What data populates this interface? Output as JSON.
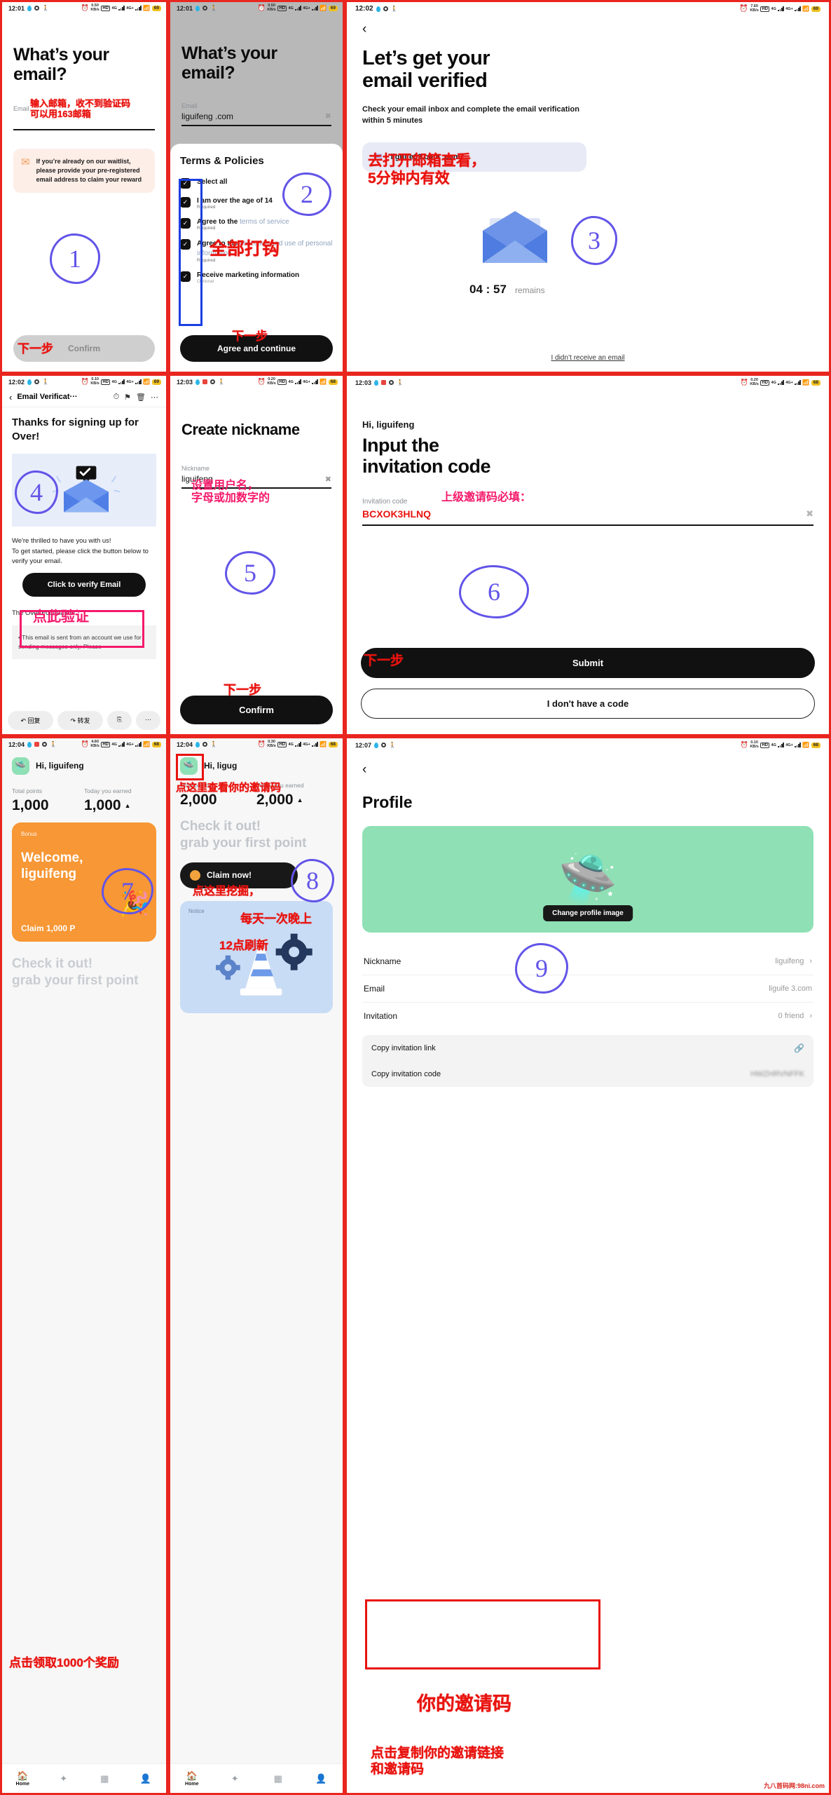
{
  "meta": {
    "watermark": "九八首码网:98ni.com"
  },
  "panels": {
    "p1": {
      "status": {
        "time": "12:01",
        "speed": "0.50",
        "unit": "KB/s",
        "battery": "69",
        "hd": "HD",
        "net": "4G",
        "net2": "4G+"
      },
      "title": "What’s your\nemail?",
      "field_label": "Email",
      "field_value": "",
      "notice": "If you’re already on our waitlist, please provide your pre-registered email address to claim your reward",
      "notice_icon": "envelope-icon",
      "confirm_label": "Confirm",
      "ann_red": "输入邮箱，收不到验证码\n可以用163邮箱",
      "ann_step": "下一步",
      "step_number": "1"
    },
    "p2": {
      "status": {
        "time": "12:01",
        "speed": "0.50",
        "unit": "KB/s",
        "battery": "69",
        "hd": "HD",
        "net": "4G",
        "net2": "4G+"
      },
      "title": "What’s your\nemail?",
      "field_label": "Email",
      "field_value": "liguifeng        .com",
      "clear_icon": "clear-icon",
      "sheet_title": "Terms & Policies",
      "terms": [
        {
          "label": "Select all",
          "link": "",
          "sub": "",
          "checked": true
        },
        {
          "label": "I am over the age of 14",
          "link": "",
          "sub": "Required",
          "checked": true
        },
        {
          "label": "Agree to the ",
          "link": "terms of service",
          "sub": "Required",
          "checked": true
        },
        {
          "label": "Agree to the ",
          "link": "collection and use of personal information",
          "sub": "Required",
          "checked": true
        },
        {
          "label": "Receive marketing information",
          "link": "",
          "sub": "Optional",
          "checked": true
        }
      ],
      "agree_label": "Agree and continue",
      "ann_red": "全部打钩",
      "ann_step": "下一步",
      "step_number": "2"
    },
    "p3": {
      "status": {
        "time": "12:02",
        "speed": "7.60",
        "unit": "KB/s",
        "battery": "69",
        "hd": "HD",
        "net": "4G",
        "net2": "4G+"
      },
      "back_icon": "back-chevron-icon",
      "title": "Let’s get your\nemail verified",
      "subtitle": "Check your email inbox and complete the email verification within 5 minutes",
      "email_chip": "liguife63.com      .com",
      "email_chip_icon": "envelope-icon",
      "illustration": "open-envelope-icon",
      "timer": "04 : 57",
      "timer_suffix": "remains",
      "resend_link": "I didn’t receive an email",
      "ann_red": "去打开邮箱查看，\n5分钟内有效",
      "step_number": "3"
    },
    "p4": {
      "status": {
        "time": "12:02",
        "speed": "0.10",
        "unit": "KB/s",
        "battery": "69",
        "hd": "HD",
        "net": "4G",
        "net2": "4G+"
      },
      "mail_subject": "Email Verificat···",
      "toolbar_icons": [
        "back-chevron-icon",
        "clock-icon",
        "flag-icon",
        "trash-icon",
        "more-icon"
      ],
      "heading": "Thanks for signing up for Over!",
      "hero_icon": "verified-envelope-icon",
      "body": "We're thrilled to have you with us!\nTo get started, please click the button below to verify your email.",
      "cta_label": "Click to verify Email",
      "signature": "The Over Foundation",
      "disclaimer": "• This email is sent from an account we use for sending messages only. Please",
      "actions": [
        {
          "icon": "reply-icon",
          "label": "回复"
        },
        {
          "icon": "forward-icon",
          "label": "转发"
        },
        {
          "icon": "archive-icon",
          "label": ""
        },
        {
          "icon": "more-icon",
          "label": ""
        }
      ],
      "ann_pink": "点此验证",
      "step_number": "4"
    },
    "p5": {
      "status": {
        "time": "12:03",
        "speed": "0.20",
        "unit": "KB/s",
        "battery": "68",
        "hd": "HD",
        "net": "4G",
        "net2": "4G+"
      },
      "title": "Create nickname",
      "field_label": "Nickname",
      "field_value": "liguifeng",
      "clear_icon": "clear-icon",
      "confirm_label": "Confirm",
      "ann_pink": "设置用户名，\n字母或加数字的",
      "ann_step": "下一步",
      "step_number": "5"
    },
    "p6": {
      "status": {
        "time": "12:03",
        "speed": "0.20",
        "unit": "KB/s",
        "battery": "68",
        "hd": "HD",
        "net": "4G",
        "net2": "4G+"
      },
      "greeting": "Hi, liguifeng",
      "title": "Input the\ninvitation code",
      "field_label": "Invitation code",
      "field_value": "BCXOK3HLNQ",
      "clear_icon": "clear-icon",
      "submit_label": "Submit",
      "nocode_label": "I don't have a code",
      "ann_pink": "上级邀请码必填：",
      "ann_step": "下一步",
      "step_number": "6"
    },
    "p7": {
      "status": {
        "time": "12:04",
        "speed": "4.60",
        "unit": "KB/s",
        "battery": "68",
        "hd": "HD",
        "net": "4G",
        "net2": "4G+"
      },
      "avatar_icon": "alien-avatar-icon",
      "greeting": "Hi, liguifeng",
      "stats": [
        {
          "label": "Total points",
          "value": "1,000"
        },
        {
          "label": "Today you earned",
          "value": "1,000",
          "caret": "▲"
        }
      ],
      "bonus_tag": "Bonus",
      "bonus_title": "Welcome,\nliguifeng",
      "bonus_cta": "Claim 1,000 P",
      "promo": "Check it out!\ngrab your first point",
      "nav": [
        {
          "icon": "home-icon",
          "label": "Home",
          "active": true
        },
        {
          "icon": "sparkle-icon",
          "label": "",
          "active": false
        },
        {
          "icon": "card-icon",
          "label": "",
          "active": false
        },
        {
          "icon": "person-icon",
          "label": "",
          "active": false
        }
      ],
      "ann_red": "点击领取1000个奖励",
      "step_number": "7"
    },
    "p8": {
      "status": {
        "time": "12:04",
        "speed": "0.30",
        "unit": "KB/s",
        "battery": "68",
        "hd": "HD",
        "net": "4G",
        "net2": "4G+"
      },
      "avatar_icon": "alien-avatar-icon",
      "greeting": "Hi, ligug",
      "stats": [
        {
          "label": "Total points",
          "value": "2,000"
        },
        {
          "label": "Today you earned",
          "value": "2,000",
          "caret": "▲"
        }
      ],
      "promo": "Check it out!\ngrab your first point",
      "claim_label": "Claim now!",
      "notice_tag": "Notice",
      "notice_icon": "cone-gear-icon",
      "nav": [
        {
          "icon": "home-icon",
          "label": "Home",
          "active": true
        },
        {
          "icon": "sparkle-icon",
          "label": "",
          "active": false
        },
        {
          "icon": "card-icon",
          "label": "",
          "active": false
        },
        {
          "icon": "person-icon",
          "label": "",
          "active": false
        }
      ],
      "ann_red_top": "点这里查看你的邀请码",
      "ann_red_mid": "点这里挖掘，",
      "ann_red_mid2": "每天一次晚上",
      "ann_red_mid3": "12点刷新",
      "step_number": "8"
    },
    "p9": {
      "status": {
        "time": "12:07",
        "speed": "0.10",
        "unit": "KB/s",
        "battery": "68",
        "hd": "HD",
        "net": "4G",
        "net2": "4G+"
      },
      "back_icon": "back-chevron-icon",
      "title": "Profile",
      "avatar_icon": "alien-avatar-icon",
      "change_image_label": "Change profile image",
      "rows": [
        {
          "label": "Nickname",
          "value": "liguifeng",
          "chevron": "›"
        },
        {
          "label": "Email",
          "value": "liguife        3.com",
          "chevron": ""
        },
        {
          "label": "Invitation",
          "value": "0 friend",
          "chevron": "›"
        }
      ],
      "copy_rows": [
        {
          "label": "Copy invitation link",
          "value": "",
          "icon": "link-icon"
        },
        {
          "label": "Copy invitation code",
          "value": "HWZHRVNFFK",
          "icon": ""
        }
      ],
      "ann_red": "你的邀请码",
      "ann_red2": "点击复制你的邀请链接\n和邀请码",
      "step_number": "9"
    }
  }
}
